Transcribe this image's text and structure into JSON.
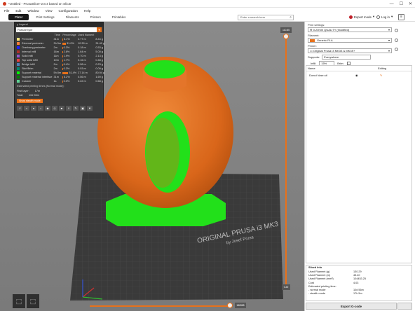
{
  "window": {
    "title": "*Untitled - PrusaSlicer-2.8.4 based on Slic3r",
    "controls": [
      "—",
      "☐",
      "✕"
    ]
  },
  "menu": [
    "File",
    "Edit",
    "Window",
    "View",
    "Configuration",
    "Help"
  ],
  "tabs": [
    "Plater",
    "Print Settings",
    "Filaments",
    "Printers",
    "Printables"
  ],
  "search": {
    "placeholder": "Enter a search term"
  },
  "mode": {
    "label": "Expert mode",
    "color": "#c0202a"
  },
  "login": {
    "label": "Log in"
  },
  "legend": {
    "header": "Legend",
    "selection": "Feature type",
    "columns": [
      "",
      "Time",
      "Percentage",
      "Used filament"
    ],
    "rows": [
      {
        "name": "Perimeter",
        "color": "#ffe680",
        "time": "31m",
        "pct": "5.1%",
        "pct_value": 5.1,
        "used": "2.77 m",
        "g": "8.44 g"
      },
      {
        "name": "External perimeter",
        "color": "#ff7d38",
        "time": "3h 5m",
        "pct": "31.0%",
        "pct_value": 31.0,
        "used": "10.39 m",
        "g": "31.40 g"
      },
      {
        "name": "Overhang perimeter",
        "color": "#1f1fff",
        "time": "2m",
        "pct": "0.3%",
        "pct_value": 0.3,
        "used": "0.18 m",
        "g": "0.53 g"
      },
      {
        "name": "Internal infill",
        "color": "#b03029",
        "time": "16m",
        "pct": "2.6%",
        "pct_value": 2.6,
        "used": "1.64 m",
        "g": "5.00 g"
      },
      {
        "name": "Solid infill",
        "color": "#9654cc",
        "time": "11m",
        "pct": "1.9%",
        "pct_value": 1.9,
        "used": "0.70 m",
        "g": "2.13 g"
      },
      {
        "name": "Top solid infill",
        "color": "#f04040",
        "time": "10m",
        "pct": "1.7%",
        "pct_value": 1.7,
        "used": "0.16 m",
        "g": "0.48 g"
      },
      {
        "name": "Bridge infill",
        "color": "#4d80ba",
        "time": "2m",
        "pct": "0.4%",
        "pct_value": 0.4,
        "used": "0.08 m",
        "g": "0.23 g"
      },
      {
        "name": "Skirt/Brim",
        "color": "#00876e",
        "time": "2m",
        "pct": "0.3%",
        "pct_value": 0.3,
        "used": "0.03 m",
        "g": "0.09 g"
      },
      {
        "name": "Support material",
        "color": "#00ff00",
        "time": "5h 8m",
        "pct": "51.4%",
        "pct_value": 51.4,
        "used": "27.14 m",
        "g": "80.94 g"
      },
      {
        "name": "Support material interface",
        "color": "#008000",
        "time": "31m",
        "pct": "5.2%",
        "pct_value": 5.2,
        "used": "0.56 m",
        "g": "1.69 g"
      },
      {
        "name": "Custom",
        "color": "#5ed194",
        "time": "1s",
        "pct": "0.0%",
        "pct_value": 0.0,
        "used": "0.22 m",
        "g": "0.68 g"
      }
    ],
    "estimated": "Estimated printing times [Normal mode]:",
    "modes": [
      {
        "k": "First layer:",
        "v": "17m"
      },
      {
        "k": "Total:",
        "v": "10d 56m"
      }
    ],
    "stealth_button": "Show stealth mode"
  },
  "sliders": {
    "top_value": "110.85",
    "bottom_value": "0.20",
    "horizontal_value": "186585",
    "vertical_pos": 1.0,
    "horizontal_pos": 1.0
  },
  "panel": {
    "print_settings_label": "Print settings:",
    "print_settings": "0.20mm QUALITY (modified)",
    "filament_label": "Filament:",
    "filament": "Generic PLA",
    "filament_color": "#e8711a",
    "printer_label": "Printer:",
    "printer": "Original Prusa i3 MK3S & MK3S+",
    "supports_label": "Supports:",
    "supports": "Everywhere",
    "infill_label": "Infill:",
    "infill": "15%",
    "brim_label": "Brim:"
  },
  "objects": {
    "headers": [
      "Name",
      "Editing"
    ],
    "items": [
      {
        "name": "Donut Vase.stl"
      }
    ]
  },
  "sliced": {
    "title": "Sliced Info",
    "rows": [
      {
        "k": "Used Filament (g)",
        "v": "130.29"
      },
      {
        "k": "Used Filament (m)",
        "v": "43.40"
      },
      {
        "k": "Used Filament (mm³)",
        "v": "104453.25"
      },
      {
        "k": "Cost",
        "v": "4.03"
      },
      {
        "k": "Estimated printing time:",
        "v": ""
      },
      {
        "k": "- normal mode",
        "v": "10d 56m"
      },
      {
        "k": "- stealth mode",
        "v": "17h 5m"
      }
    ]
  },
  "export": {
    "label": "Export G-code"
  },
  "bed": {
    "text1": "ORIGINAL PRUSA i3 MK3",
    "text2": "by Josef Prusa"
  }
}
